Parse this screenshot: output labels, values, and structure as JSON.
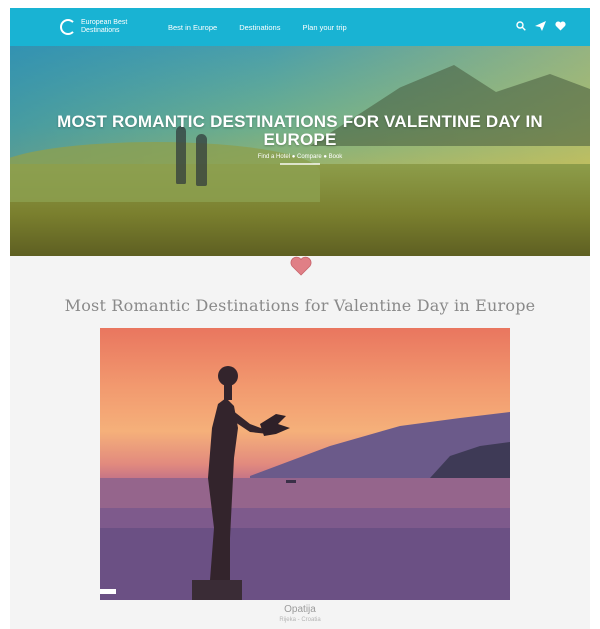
{
  "nav": {
    "logo_text": "European Best Destinations",
    "links": [
      "Best in Europe",
      "Destinations",
      "Plan your trip"
    ],
    "icons": [
      "search-icon",
      "send-icon",
      "heart-icon"
    ]
  },
  "hero": {
    "title": "MOST ROMANTIC DESTINATIONS FOR VALENTINE DAY IN EUROPE",
    "subtitle": "Find a Hotel ● Compare ● Book"
  },
  "content": {
    "heading": "Most Romantic Destinations for Valentine Day in Europe",
    "photo_caption": "Opatija",
    "photo_subcaption": "Rijeka - Croatia"
  },
  "colors": {
    "nav_bg": "#19b3d3",
    "heart": "#e07f86",
    "heading": "#8a8a8a"
  }
}
